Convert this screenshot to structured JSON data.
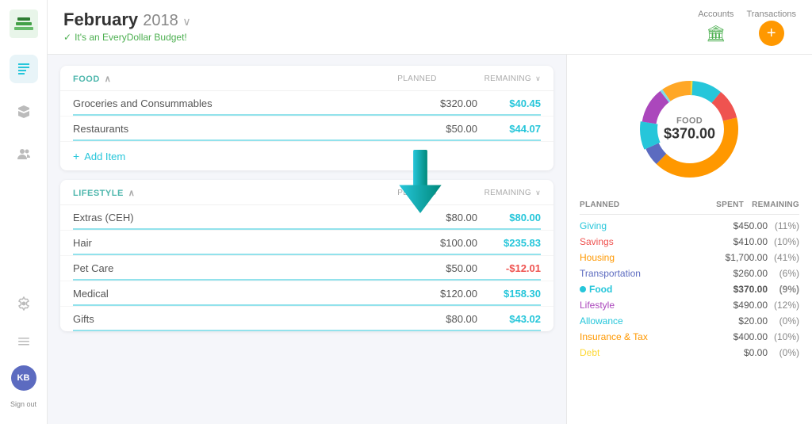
{
  "sidebar": {
    "logo_text": "ED",
    "avatar_initials": "KB",
    "sign_out": "Sign out",
    "nav_items": [
      "budget-icon",
      "box-icon",
      "people-icon",
      "settings-icon",
      "gear-icon"
    ]
  },
  "header": {
    "month": "February",
    "year": "2018",
    "subtitle": "It's an EveryDollar Budget!",
    "accounts_label": "Accounts",
    "transactions_label": "Transactions"
  },
  "food_section": {
    "category": "FOOD",
    "planned_label": "PLANNED",
    "remaining_label": "REMAINING",
    "items": [
      {
        "name": "Groceries and Consummables",
        "planned": "$320.00",
        "remaining": "$40.45",
        "positive": true
      },
      {
        "name": "Restaurants",
        "planned": "$50.00",
        "remaining": "$44.07",
        "positive": true
      }
    ],
    "add_item_label": "Add Item"
  },
  "lifestyle_section": {
    "category": "LIFESTYLE",
    "planned_label": "PLANNED",
    "remaining_label": "REMAINING",
    "items": [
      {
        "name": "Extras (CEH)",
        "planned": "$80.00",
        "remaining": "$80.00",
        "positive": true
      },
      {
        "name": "Hair",
        "planned": "$100.00",
        "remaining": "$235.83",
        "positive": true
      },
      {
        "name": "Pet Care",
        "planned": "$50.00",
        "remaining": "-$12.01",
        "positive": false
      },
      {
        "name": "Medical",
        "planned": "$120.00",
        "remaining": "$158.30",
        "positive": true
      },
      {
        "name": "Gifts",
        "planned": "$80.00",
        "remaining": "$43.02",
        "positive": true
      }
    ]
  },
  "donut": {
    "category": "FOOD",
    "amount": "$370.00"
  },
  "summary": {
    "headers": [
      "PLANNED",
      "SPENT",
      "REMAINING"
    ],
    "rows": [
      {
        "name": "Giving",
        "color": "#26c6da",
        "planned": "$450.00",
        "spent": "",
        "remaining": "(11%)"
      },
      {
        "name": "Savings",
        "color": "#ef5350",
        "planned": "$410.00",
        "spent": "",
        "remaining": "(10%)"
      },
      {
        "name": "Housing",
        "color": "#ff9800",
        "planned": "$1,700.00",
        "spent": "",
        "remaining": "(41%)"
      },
      {
        "name": "Transportation",
        "color": "#5c6bc0",
        "planned": "$260.00",
        "spent": "",
        "remaining": "(6%)"
      },
      {
        "name": "Food",
        "color": "#26c6da",
        "planned": "$370.00",
        "spent": "",
        "remaining": "(9%)",
        "highlighted": true,
        "has_dot": true
      },
      {
        "name": "Lifestyle",
        "color": "#ab47bc",
        "planned": "$490.00",
        "spent": "",
        "remaining": "(12%)"
      },
      {
        "name": "Allowance",
        "color": "#26c6da",
        "planned": "$20.00",
        "spent": "",
        "remaining": "(0%)"
      },
      {
        "name": "Insurance & Tax",
        "color": "#ff9800",
        "planned": "$400.00",
        "spent": "",
        "remaining": "(10%)"
      },
      {
        "name": "Debt",
        "color": "#fdd835",
        "planned": "$0.00",
        "spent": "",
        "remaining": "(0%)"
      }
    ]
  }
}
